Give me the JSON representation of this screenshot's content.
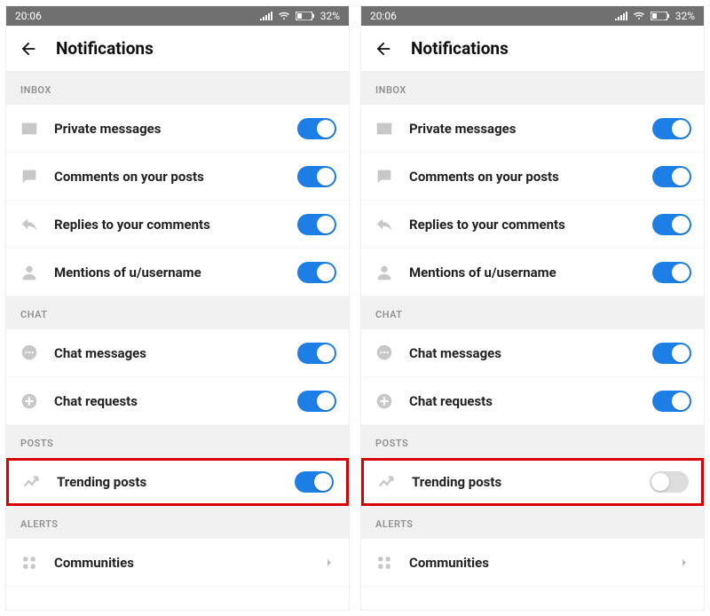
{
  "status": {
    "time": "20:06",
    "battery": "32%"
  },
  "app": {
    "title": "Notifications"
  },
  "sections": {
    "inbox": "INBOX",
    "chat": "CHAT",
    "posts": "POSTS",
    "alerts": "ALERTS"
  },
  "left": {
    "rows": {
      "private_messages": {
        "label": "Private messages",
        "on": true
      },
      "comments_on_posts": {
        "label": "Comments on your posts",
        "on": true
      },
      "replies": {
        "label": "Replies to your comments",
        "on": true
      },
      "mentions": {
        "label": "Mentions of u/username",
        "on": true
      },
      "chat_messages": {
        "label": "Chat messages",
        "on": true
      },
      "chat_requests": {
        "label": "Chat requests",
        "on": true
      },
      "trending": {
        "label": "Trending posts",
        "on": true
      },
      "communities": {
        "label": "Communities"
      }
    }
  },
  "right": {
    "rows": {
      "private_messages": {
        "label": "Private messages",
        "on": true
      },
      "comments_on_posts": {
        "label": "Comments on your posts",
        "on": true
      },
      "replies": {
        "label": "Replies to your comments",
        "on": true
      },
      "mentions": {
        "label": "Mentions of u/username",
        "on": true
      },
      "chat_messages": {
        "label": "Chat messages",
        "on": true
      },
      "chat_requests": {
        "label": "Chat requests",
        "on": true
      },
      "trending": {
        "label": "Trending posts",
        "on": false
      },
      "communities": {
        "label": "Communities"
      }
    }
  }
}
